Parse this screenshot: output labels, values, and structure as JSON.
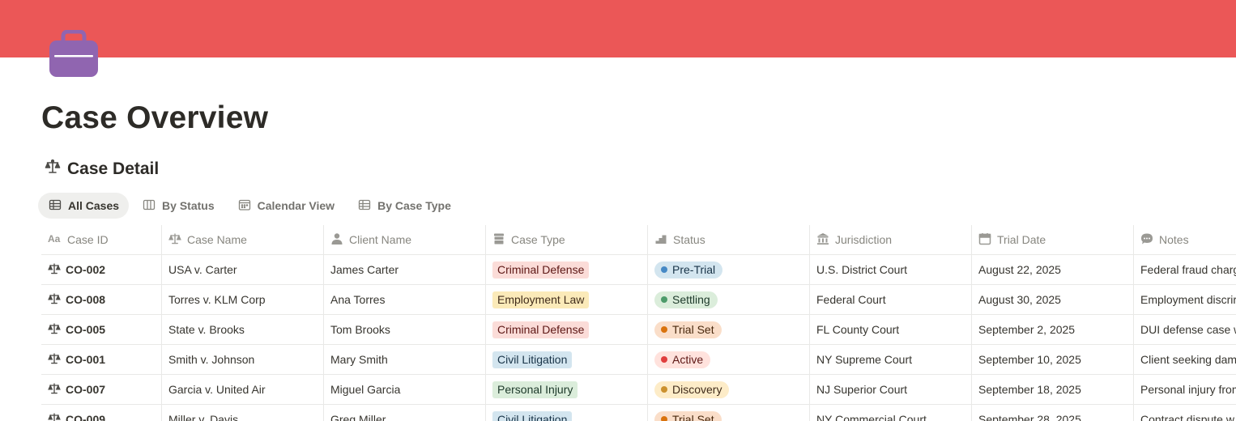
{
  "page": {
    "title": "Case Overview",
    "cover_color": "#eb5757",
    "icon": "briefcase-icon",
    "icon_color": "#9065b0"
  },
  "database": {
    "title": "Case Detail",
    "icon": "scales-icon"
  },
  "views": [
    {
      "label": "All Cases",
      "icon": "table-icon",
      "active": true
    },
    {
      "label": "By Status",
      "icon": "board-icon",
      "active": false
    },
    {
      "label": "Calendar View",
      "icon": "calendar-icon",
      "active": false
    },
    {
      "label": "By Case Type",
      "icon": "table-icon",
      "active": false
    }
  ],
  "columns": [
    {
      "label": "Case ID",
      "icon": "text-property-icon"
    },
    {
      "label": "Case Name",
      "icon": "scales-icon"
    },
    {
      "label": "Client Name",
      "icon": "person-icon"
    },
    {
      "label": "Case Type",
      "icon": "archive-icon"
    },
    {
      "label": "Status",
      "icon": "stairs-icon"
    },
    {
      "label": "Jurisdiction",
      "icon": "courthouse-icon"
    },
    {
      "label": "Trial Date",
      "icon": "calendar-icon"
    },
    {
      "label": "Notes",
      "icon": "comment-icon"
    }
  ],
  "rows": [
    {
      "id": "CO-002",
      "name": "USA v. Carter",
      "client": "James Carter",
      "type": "Criminal Defense",
      "type_color": "red",
      "status": "Pre-Trial",
      "status_color": "blue",
      "jurisdiction": "U.S. District Court",
      "date": "August 22, 2025",
      "notes": "Federal fraud charg"
    },
    {
      "id": "CO-008",
      "name": "Torres v. KLM Corp",
      "client": "Ana Torres",
      "type": "Employment Law",
      "type_color": "yellow",
      "status": "Settling",
      "status_color": "green",
      "jurisdiction": "Federal Court",
      "date": "August 30, 2025",
      "notes": "Employment discrir"
    },
    {
      "id": "CO-005",
      "name": "State v. Brooks",
      "client": "Tom Brooks",
      "type": "Criminal Defense",
      "type_color": "red",
      "status": "Trial Set",
      "status_color": "orange",
      "jurisdiction": "FL County Court",
      "date": "September 2, 2025",
      "notes": "DUI defense case w"
    },
    {
      "id": "CO-001",
      "name": "Smith v. Johnson",
      "client": "Mary Smith",
      "type": "Civil Litigation",
      "type_color": "blue",
      "status": "Active",
      "status_color": "red",
      "jurisdiction": "NY Supreme Court",
      "date": "September 10, 2025",
      "notes": "Client seeking dam"
    },
    {
      "id": "CO-007",
      "name": "Garcia v. United Air",
      "client": "Miguel Garcia",
      "type": "Personal Injury",
      "type_color": "green",
      "status": "Discovery",
      "status_color": "yellow",
      "jurisdiction": "NJ Superior Court",
      "date": "September 18, 2025",
      "notes": "Personal injury from"
    },
    {
      "id": "CO-009",
      "name": "Miller v. Davis",
      "client": "Greg Miller",
      "type": "Civil Litigation",
      "type_color": "blue",
      "status": "Trial Set",
      "status_color": "orange",
      "jurisdiction": "NY Commercial Court",
      "date": "September 28, 2025",
      "notes": "Contract dispute w"
    }
  ]
}
